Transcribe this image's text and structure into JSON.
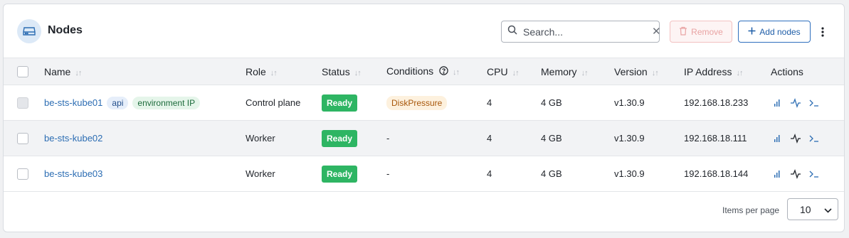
{
  "header": {
    "title": "Nodes",
    "search_placeholder": "Search...",
    "remove_label": "Remove",
    "add_label": "Add nodes"
  },
  "columns": [
    "Name",
    "Role",
    "Status",
    "Conditions",
    "CPU",
    "Memory",
    "Version",
    "IP Address",
    "Actions"
  ],
  "rows": [
    {
      "name": "be-sts-kube01",
      "tags": [
        "api",
        "environment IP"
      ],
      "role": "Control plane",
      "status": "Ready",
      "conditions": "DiskPressure",
      "cpu": "4",
      "memory": "4 GB",
      "version": "v1.30.9",
      "ip": "192.168.18.233"
    },
    {
      "name": "be-sts-kube02",
      "tags": [],
      "role": "Worker",
      "status": "Ready",
      "conditions": "-",
      "cpu": "4",
      "memory": "4 GB",
      "version": "v1.30.9",
      "ip": "192.168.18.111"
    },
    {
      "name": "be-sts-kube03",
      "tags": [],
      "role": "Worker",
      "status": "Ready",
      "conditions": "-",
      "cpu": "4",
      "memory": "4 GB",
      "version": "v1.30.9",
      "ip": "192.168.18.144"
    }
  ],
  "footer": {
    "items_per_page_label": "Items per page",
    "items_per_page_value": "10"
  },
  "colors": {
    "accent": "#2c6db3",
    "ready": "#2eb563",
    "warning_bg": "#fdf1de",
    "danger_light": "#e9a3a3"
  },
  "icons": {
    "title": "server-node-icon",
    "search": "search-icon",
    "remove": "trash-icon",
    "add": "plus-icon",
    "more": "more-vertical-icon",
    "help": "help-circle-icon",
    "actions": [
      "bar-chart-icon",
      "activity-icon",
      "terminal-icon"
    ]
  }
}
